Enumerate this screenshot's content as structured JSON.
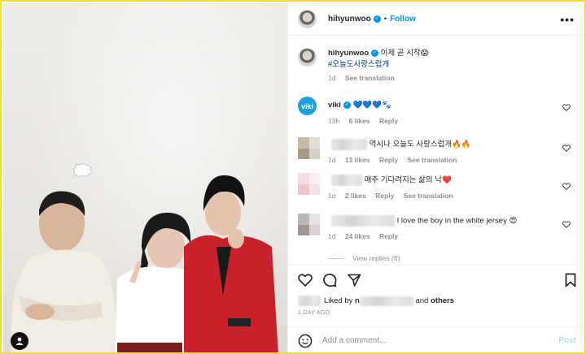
{
  "header": {
    "username": "hihyunwoo",
    "follow_label": "Follow",
    "more_label": "•••"
  },
  "caption": {
    "username": "hihyunwoo",
    "text": "이제 곧 시작😱",
    "hashtag": "#오늘도사랑스럽개",
    "time": "1d",
    "translate_label": "See translation"
  },
  "comments": [
    {
      "username": "viki",
      "text": "💙💙💙🐾",
      "time": "13h",
      "likes": "6 likes",
      "reply": "Reply",
      "translate": ""
    },
    {
      "username": "",
      "text": "역시나 오늘도 사랑스럽개🔥🔥",
      "time": "1d",
      "likes": "13 likes",
      "reply": "Reply",
      "translate": "See translation"
    },
    {
      "username": "",
      "text": "매주 기다려지는 삶의 낙❤️",
      "time": "1d",
      "likes": "2 likes",
      "reply": "Reply",
      "translate": "See translation"
    },
    {
      "username": "",
      "text": "I love the boy in the white jersey 😍",
      "time": "1d",
      "likes": "24 likes",
      "reply": "Reply",
      "translate": ""
    }
  ],
  "view_replies": "View replies (6)",
  "likes_line": {
    "prefix": "Liked by",
    "name_start": "n",
    "and_label": "and",
    "others": "others"
  },
  "date": "1 DAY AGO",
  "add_comment": {
    "placeholder": "Add a comment...",
    "post_label": "Post"
  },
  "colors": {
    "frame": "#f2dc3a",
    "link_blue": "#0095f6",
    "muted": "#8e8e8e",
    "jacket_red": "#c8212b"
  },
  "icons": [
    "heart-icon",
    "comment-icon",
    "share-icon",
    "bookmark-icon",
    "emoji-icon",
    "verified-icon",
    "person-tag-icon"
  ]
}
